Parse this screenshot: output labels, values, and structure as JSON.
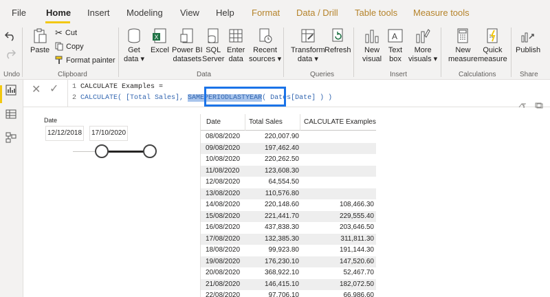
{
  "menu": {
    "items": [
      "File",
      "Home",
      "Insert",
      "Modeling",
      "View",
      "Help",
      "Format",
      "Data / Drill",
      "Table tools",
      "Measure tools"
    ],
    "active": "Home"
  },
  "ribbon": {
    "undo": {
      "label": "Undo"
    },
    "clipboard": {
      "paste": "Paste",
      "cut": "Cut",
      "copy": "Copy",
      "format_painter": "Format painter",
      "group": "Clipboard"
    },
    "data": {
      "get_data": [
        "Get",
        "data ▾"
      ],
      "excel": "Excel",
      "powerbi": [
        "Power BI",
        "datasets"
      ],
      "sql": [
        "SQL",
        "Server"
      ],
      "enter": [
        "Enter",
        "data"
      ],
      "recent": [
        "Recent",
        "sources ▾"
      ],
      "group": "Data"
    },
    "queries": {
      "transform": [
        "Transform",
        "data ▾"
      ],
      "refresh": "Refresh",
      "group": "Queries"
    },
    "insert": {
      "new_visual": [
        "New",
        "visual"
      ],
      "text_box": [
        "Text",
        "box"
      ],
      "more_visuals": [
        "More",
        "visuals ▾"
      ],
      "group": "Insert"
    },
    "calculations": {
      "new_measure": [
        "New",
        "measure"
      ],
      "quick_measure": [
        "Quick",
        "measure"
      ],
      "group": "Calculations"
    },
    "share": {
      "publish": "Publish",
      "group": "Share"
    }
  },
  "formula": {
    "line1_num": "1",
    "line1": "CALCULATE Examples =",
    "line2_num": "2",
    "line2_a": "CALCULATE( [Total Sales], ",
    "line2_sel": "SAMEPERIODLASTYEAR",
    "line2_b": "( Dates[Date] ) )"
  },
  "slicer": {
    "title": "Date",
    "start": "12/12/2018",
    "end": "17/10/2020",
    "range_fraction": [
      0.62,
      1.0
    ]
  },
  "table": {
    "headers": [
      "Date",
      "Total Sales",
      "CALCULATE Examples"
    ],
    "rows": [
      [
        "08/08/2020",
        "220,007.90",
        ""
      ],
      [
        "09/08/2020",
        "197,462.40",
        ""
      ],
      [
        "10/08/2020",
        "220,262.50",
        ""
      ],
      [
        "11/08/2020",
        "123,608.30",
        ""
      ],
      [
        "12/08/2020",
        "64,554.50",
        ""
      ],
      [
        "13/08/2020",
        "110,576.80",
        ""
      ],
      [
        "14/08/2020",
        "220,148.60",
        "108,466.30"
      ],
      [
        "15/08/2020",
        "221,441.70",
        "229,555.40"
      ],
      [
        "16/08/2020",
        "437,838.30",
        "203,646.50"
      ],
      [
        "17/08/2020",
        "132,385.30",
        "311,811.30"
      ],
      [
        "18/08/2020",
        "99,923.80",
        "191,144.30"
      ],
      [
        "19/08/2020",
        "176,230.10",
        "147,520.60"
      ],
      [
        "20/08/2020",
        "368,922.10",
        "52,467.70"
      ],
      [
        "21/08/2020",
        "146,415.10",
        "182,072.50"
      ],
      [
        "22/08/2020",
        "97,706.10",
        "66,986.60"
      ]
    ]
  },
  "colors": {
    "accent": "#f2c811",
    "highlight_box": "#1a73e8",
    "dax_function": "#3165b0",
    "context_tab": "#b5832a"
  }
}
